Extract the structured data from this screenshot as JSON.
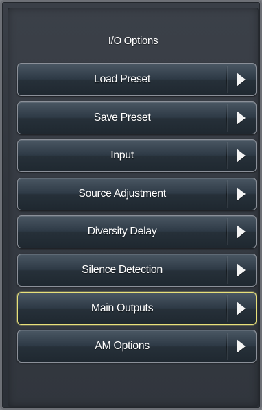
{
  "header": {
    "title": "I/O Options"
  },
  "menu": {
    "items": [
      {
        "label": "Load Preset",
        "icon": "chevron-right-icon",
        "selected": false
      },
      {
        "label": "Save Preset",
        "icon": "chevron-right-icon",
        "selected": false
      },
      {
        "label": "Input",
        "icon": "chevron-right-icon",
        "selected": false
      },
      {
        "label": "Source Adjustment",
        "icon": "chevron-right-icon",
        "selected": false
      },
      {
        "label": "Diversity Delay",
        "icon": "chevron-right-icon",
        "selected": false
      },
      {
        "label": "Silence Detection",
        "icon": "chevron-right-icon",
        "selected": false
      },
      {
        "label": "Main Outputs",
        "icon": "chevron-right-icon",
        "selected": true
      },
      {
        "label": "AM Options",
        "icon": "chevron-right-icon",
        "selected": false
      }
    ]
  },
  "colors": {
    "background": "#353a42",
    "button_border": "#8b9099",
    "selected_border": "#e8e07a",
    "text": "#ffffff"
  }
}
